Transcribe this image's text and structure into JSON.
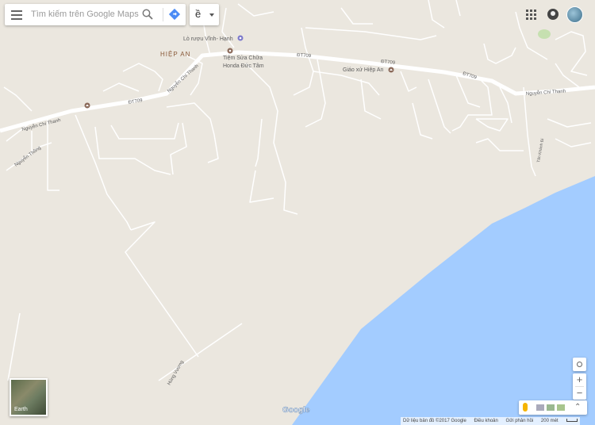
{
  "search": {
    "placeholder": "Tìm kiếm trên Google Maps",
    "menu_icon": "hamburger-menu-icon",
    "search_icon": "magnifier-icon",
    "directions_icon": "directions-diamond-icon"
  },
  "language": {
    "glyph": "ề"
  },
  "header_right": {
    "apps_icon": "apps-grid-icon",
    "notifications_icon": "notifications-icon",
    "avatar_icon": "account-avatar-icon"
  },
  "map": {
    "colors": {
      "land": "#ebe7df",
      "road": "#ffffff",
      "water": "#a3ccff",
      "label": "#5e5e5e",
      "park": "#c6e0b0",
      "town_label": "#8a5a3a"
    },
    "labels": {
      "town": "HIỆP AN",
      "poi_lo_ruou": "Lò rượu Vĩnh- Hạnh",
      "poi_tiem_line1": "Tiệm Sửa Chữa",
      "poi_tiem_line2": "Honda Đức Tâm",
      "poi_giao_xu": "Giáo xứ Hiệp An",
      "road_dt709_a": "ĐT709",
      "road_dt709_b": "ĐT709",
      "road_dt709_c": "ĐT709",
      "road_dt709_d": "ĐT709",
      "road_ncthanh_a": "Nguyễn Chí Thanh",
      "road_ncthanh_b": "Nguyễn Chí Thanh",
      "road_ncthanh_c": "Nguyễn Chí Thanh",
      "road_nthong": "Nguyễn Thông",
      "road_hung_vuong": "Hùng Vương",
      "road_tan_khanh": "Tân Khánh Đi"
    }
  },
  "controls": {
    "earth_label": "Earth",
    "zoom_in": "+",
    "zoom_out": "−",
    "locate_icon": "my-location-icon",
    "pegman_icon": "pegman-icon",
    "expand_icon": "expand-chevrons-icon",
    "expand_glyph": "⌃"
  },
  "footer": {
    "data": "Dữ liệu bản đồ ©2017 Google",
    "terms": "Điều khoản",
    "feedback": "Gửi phản hồi",
    "scale": "200 mét"
  },
  "logo": "Google"
}
